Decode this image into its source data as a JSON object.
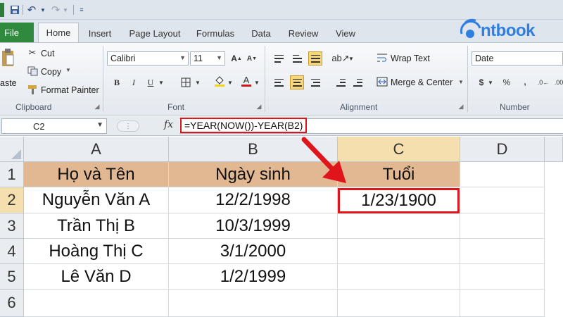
{
  "logo": {
    "text": "ntbook"
  },
  "ribbon_tabs": [
    "File",
    "Home",
    "Insert",
    "Page Layout",
    "Formulas",
    "Data",
    "Review",
    "View"
  ],
  "clipboard": {
    "paste": "aste",
    "cut": "Cut",
    "copy": "Copy",
    "format_painter": "Format Painter",
    "label": "Clipboard"
  },
  "font": {
    "name": "Calibri",
    "size": "11",
    "label": "Font"
  },
  "alignment": {
    "wrap_text": "Wrap Text",
    "merge_center": "Merge & Center",
    "label": "Alignment"
  },
  "number": {
    "format": "Date",
    "label": "Number"
  },
  "formula_bar": {
    "cell_ref": "C2",
    "fx": "fx",
    "formula": "=YEAR(NOW())-YEAR(B2)"
  },
  "columns": [
    "A",
    "B",
    "C",
    "D"
  ],
  "rows": [
    "1",
    "2",
    "3",
    "4",
    "5",
    "6"
  ],
  "table": {
    "headers": [
      "Họ và Tên",
      "Ngày sinh",
      "Tuổi"
    ],
    "rows": [
      [
        "Nguyễn Văn A",
        "12/2/1998",
        "1/23/1900"
      ],
      [
        "Trần Thị B",
        "10/3/1999",
        ""
      ],
      [
        "Hoàng Thị C",
        "3/1/2000",
        ""
      ],
      [
        "Lê Văn D",
        "1/2/1999",
        ""
      ]
    ]
  },
  "colors": {
    "header_fill": "#e2b893",
    "highlight": "#e0141b",
    "logo": "#2f7fe0",
    "file_tab": "#2f8a3e"
  }
}
